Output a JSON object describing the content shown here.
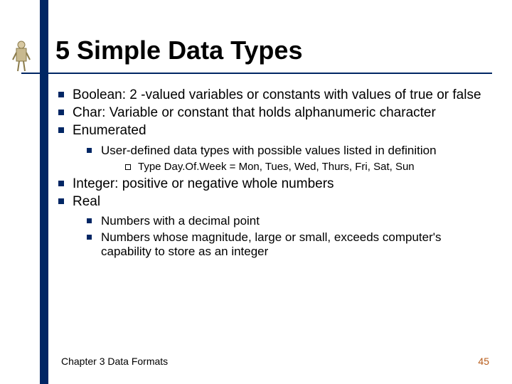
{
  "title": "5 Simple Data Types",
  "bullets": {
    "b1": "Boolean: 2 -valued variables or constants with values of true or false",
    "b2": "Char: Variable or constant that holds alphanumeric character",
    "b3": "Enumerated",
    "b3_s1": "User-defined data types with possible values listed in definition",
    "b3_s1_i1": "Type Day.Of.Week = Mon, Tues, Wed, Thurs, Fri, Sat, Sun",
    "b4": "Integer: positive or negative whole numbers",
    "b5": "Real",
    "b5_s1": "Numbers with a decimal point",
    "b5_s2": "Numbers whose magnitude, large or small, exceeds computer's capability to store as an integer"
  },
  "footer": {
    "chapter": "Chapter 3 Data Formats",
    "page": "45"
  },
  "colors": {
    "accent": "#002664",
    "page_no": "#b85c1a"
  }
}
